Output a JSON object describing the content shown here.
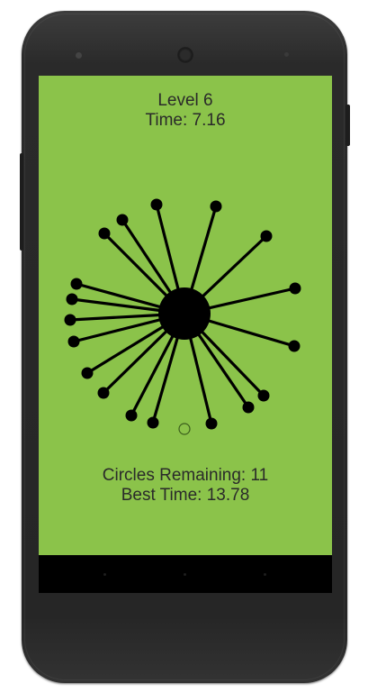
{
  "game": {
    "level_label": "Level 6",
    "time_label": "Time: 7.16",
    "circles_remaining_label": "Circles Remaining: 11",
    "best_time_label": "Best Time: 13.78",
    "background_color": "#8bc34a",
    "pin_color": "#000000",
    "attached_pin_count": 18,
    "pending_circles_shown": 1
  }
}
